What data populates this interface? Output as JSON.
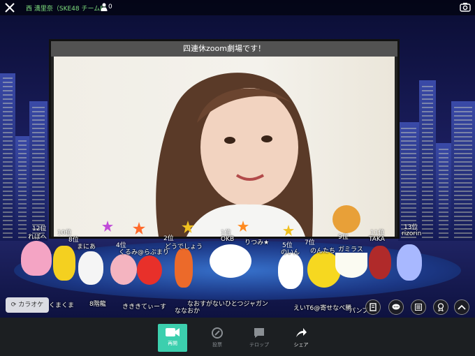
{
  "header": {
    "room_title": "西 満里奈（SKE48 チームE）",
    "viewer_count": "0"
  },
  "video": {
    "title": "四連休zoom劇場です！"
  },
  "ranking": [
    {
      "rank": "12位"
    },
    {
      "rank": "10位"
    },
    {
      "rank": "8位"
    },
    {
      "rank": "4位"
    },
    {
      "rank": "2位"
    },
    {
      "rank": "1位"
    },
    {
      "rank": "5位"
    },
    {
      "rank": "7位"
    },
    {
      "rank": "9位"
    },
    {
      "rank": "11位"
    },
    {
      "rank": "13位"
    }
  ],
  "comments": [
    {
      "text": "れぽへ"
    },
    {
      "text": "まにあ"
    },
    {
      "text": "くるみ@らぶまり"
    },
    {
      "text": "どうでしょう"
    },
    {
      "text": "OKB"
    },
    {
      "text": "りつみ★"
    },
    {
      "text": "のいん"
    },
    {
      "text": "のんたち"
    },
    {
      "text": "ガミラス"
    },
    {
      "text": "TAKA"
    },
    {
      "text": "rizorin"
    },
    {
      "text": "くまくま"
    },
    {
      "text": "8階龍"
    },
    {
      "text": "きききてぃーす"
    },
    {
      "text": "ななおか"
    },
    {
      "text": "なおすがないひとつジャガン"
    },
    {
      "text": "えいT6@寄せなべ勝"
    },
    {
      "text": "パンプ"
    }
  ],
  "controls": {
    "karaoke_label": "カラオケ"
  },
  "bottom_tabs": [
    {
      "label": "再開"
    },
    {
      "label": "投票"
    },
    {
      "label": "テロップ"
    },
    {
      "label": "シェア"
    }
  ],
  "colors": {
    "active_tab": "#3ccfae",
    "room_title": "#7fe07f"
  }
}
